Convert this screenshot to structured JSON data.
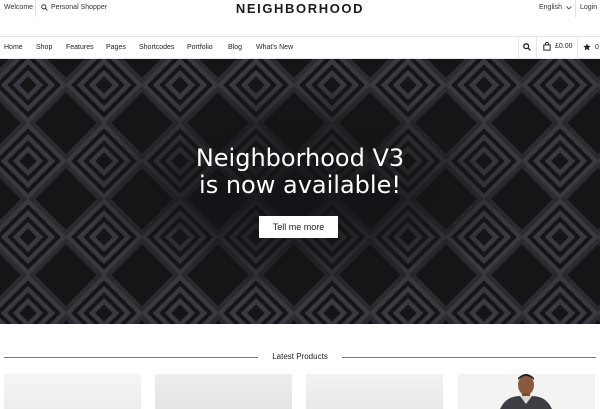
{
  "topbar": {
    "welcome": "Welcome",
    "personal_shopper": "Personal Shopper",
    "language": "English",
    "login": "Login"
  },
  "logo": "NEIGHBORHOOD",
  "nav": {
    "items": [
      "Home",
      "Shop",
      "Features",
      "Pages",
      "Shortcodes",
      "Portfolio",
      "Blog",
      "What's New"
    ],
    "cart_total": "£0.00",
    "wishlist_count": "0"
  },
  "hero": {
    "line1": "Neighborhood V3",
    "line2": "is now available!",
    "cta": "Tell me more"
  },
  "latest_products": {
    "title": "Latest Products"
  },
  "icons": {
    "search": "search-icon",
    "cart": "shopping-bag-icon",
    "wishlist": "star-icon",
    "language_dropdown": "chevron-down-icon"
  },
  "colors": {
    "hero_background": "#151417",
    "pattern": "#3a393f",
    "button_background": "#ffffff",
    "text": "#222222"
  }
}
